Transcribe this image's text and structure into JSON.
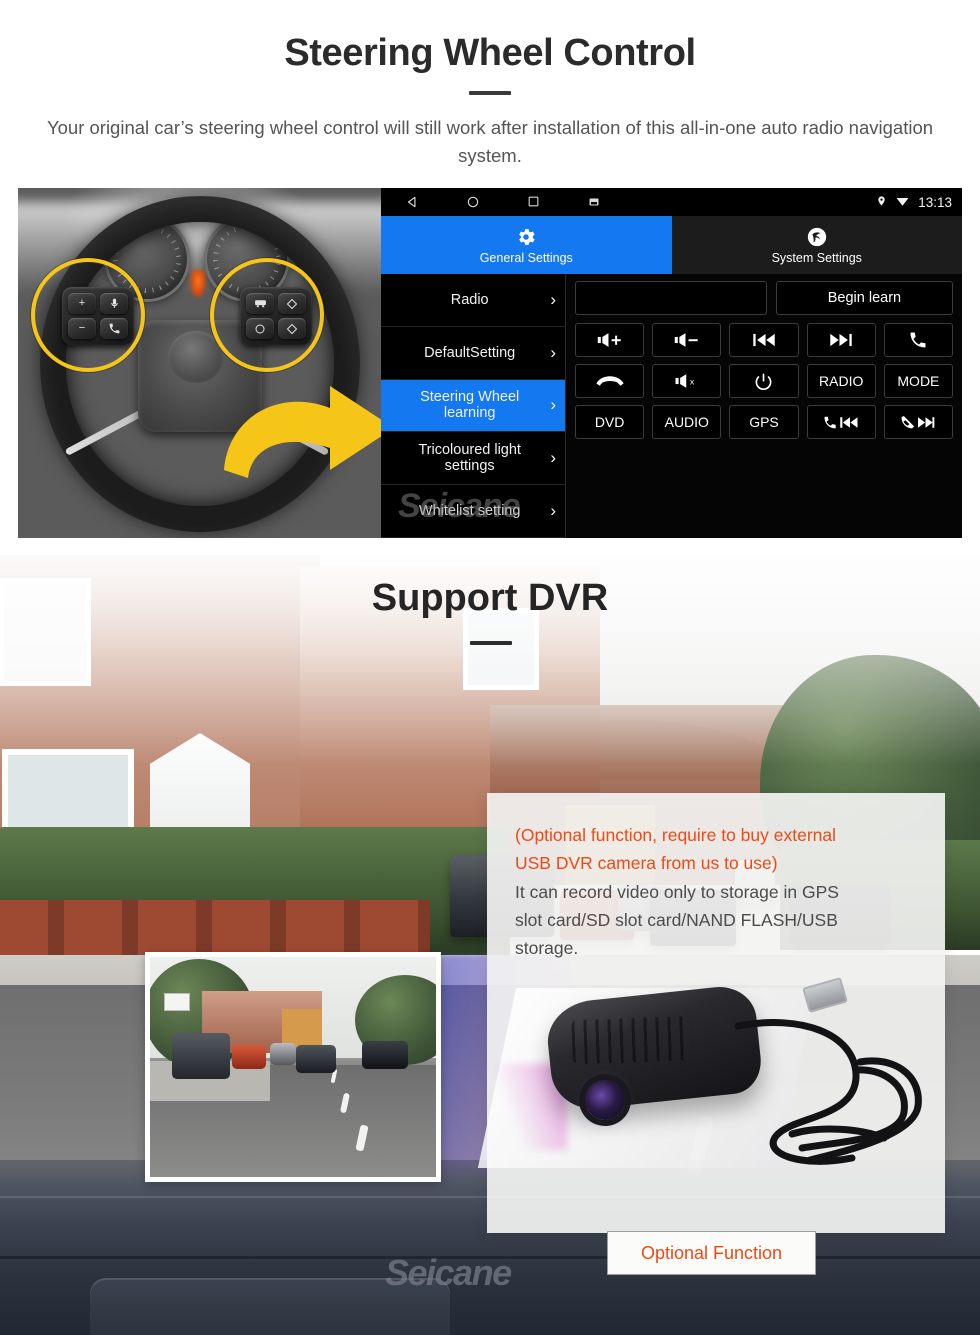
{
  "sections": {
    "steering": {
      "title": "Steering Wheel Control",
      "subtitle": "Your original car’s steering wheel control will still work after installation of this all-in-one auto radio navigation system.",
      "watermark": "Seicane"
    },
    "dvr": {
      "title": "Support DVR",
      "note_highlight_line1": "(Optional function, require to buy external",
      "note_highlight_line2": "USB DVR camera from us to use)",
      "note_plain_line1": "It can record video only to storage in GPS",
      "note_plain_line2": "slot card/SD slot card/NAND FLASH/USB",
      "note_plain_line3": "storage.",
      "optional_button": "Optional Function",
      "watermark": "Seicane"
    }
  },
  "head_unit": {
    "status_bar": {
      "back_icon": "back-triangle-icon",
      "home_icon": "home-circle-icon",
      "recents_icon": "recents-square-icon",
      "screenshot_icon": "screenshot-icon",
      "location_icon": "location-pin-icon",
      "wifi_icon": "wifi-icon",
      "time": "13:13"
    },
    "tabs": [
      {
        "label": "General Settings",
        "icon": "gear-icon",
        "active": true
      },
      {
        "label": "System Settings",
        "icon": "system-logo-icon",
        "active": false
      }
    ],
    "menu": [
      {
        "label": "Radio",
        "selected": false,
        "dim": false
      },
      {
        "label": "DefaultSetting",
        "selected": false,
        "dim": false
      },
      {
        "label": "Steering Wheel learning",
        "selected": true,
        "dim": false
      },
      {
        "label": "Tricoloured light settings",
        "selected": false,
        "dim": false
      },
      {
        "label": "Whitelist setting",
        "selected": false,
        "dim": true
      }
    ],
    "chevron": "›",
    "learn": {
      "input_value": "",
      "input_placeholder": "",
      "button_label": "Begin learn"
    },
    "key_grid": [
      {
        "label": "",
        "icon": "volume-up-icon"
      },
      {
        "label": "",
        "icon": "volume-down-icon"
      },
      {
        "label": "",
        "icon": "previous-track-icon"
      },
      {
        "label": "",
        "icon": "next-track-icon"
      },
      {
        "label": "",
        "icon": "call-answer-icon"
      },
      {
        "label": "",
        "icon": "call-hangup-icon"
      },
      {
        "label": "",
        "icon": "mute-icon"
      },
      {
        "label": "",
        "icon": "power-icon"
      },
      {
        "label": "RADIO",
        "icon": ""
      },
      {
        "label": "MODE",
        "icon": ""
      },
      {
        "label": "DVD",
        "icon": ""
      },
      {
        "label": "AUDIO",
        "icon": ""
      },
      {
        "label": "GPS",
        "icon": ""
      },
      {
        "label": "",
        "icon": "call-previous-icon"
      },
      {
        "label": "",
        "icon": "callreject-next-icon"
      }
    ],
    "bottom_bar": {
      "car_button_icon": "car-icon"
    }
  },
  "colors": {
    "accent_blue": "#1478f0",
    "accent_orange": "#ee4a16",
    "highlight_yellow": "#f5c518",
    "panel_black": "#000000",
    "title_text": "#252525"
  }
}
